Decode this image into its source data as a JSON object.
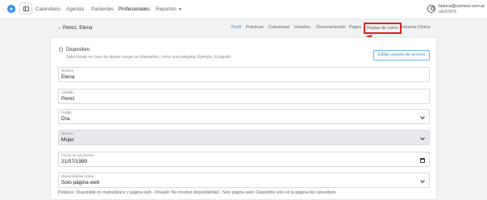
{
  "topbar": {
    "nav": [
      {
        "label": "Calendario"
      },
      {
        "label": "Agenda"
      },
      {
        "label": "Pacientes"
      },
      {
        "label": "Profesionales"
      },
      {
        "label": "Reportes"
      }
    ],
    "active_nav": "Profesionales",
    "user_email": "bianca@cormos.com.ar",
    "user_id": "a8c87b78"
  },
  "page": {
    "title": "Perez, Elena",
    "tabs": [
      "Perfil",
      "Prácticas",
      "Coberturas",
      "Horarios",
      "Documentación",
      "Pagos",
      "Reglas de cobro",
      "Historia Clínica"
    ],
    "active_tab": "Perfil",
    "highlighted_tab": "Reglas de cobro"
  },
  "form": {
    "device_label": "Dispositivo",
    "device_hint": "Seleccionar en caso de querer cargar un dispositivo, como una máquina. Ejemplo: Ecógrafo",
    "edit_access_button": "Editar usuario de acceso",
    "fields": [
      {
        "label": "Nombre",
        "value": "Elena"
      },
      {
        "label": "Apellido",
        "value": "Perez"
      },
      {
        "label": "Prefijo",
        "value": "Dra."
      },
      {
        "label": "Genero",
        "value": "Mujer"
      },
      {
        "label": "Fecha de nacimiento",
        "value": "21/07/1999"
      },
      {
        "label": "Disponibilidad online",
        "value": "Solo página web"
      }
    ],
    "availability_hint": "Públicos: Disponible en marketplace y página web - Privado: No mostrar disponibilidad - Solo página web: Disponible sólo en la página del consultorio"
  },
  "colors": {
    "accent": "#2d8cf0",
    "active_tab": "#3b8fd8",
    "annotation_red": "#d9261c"
  }
}
